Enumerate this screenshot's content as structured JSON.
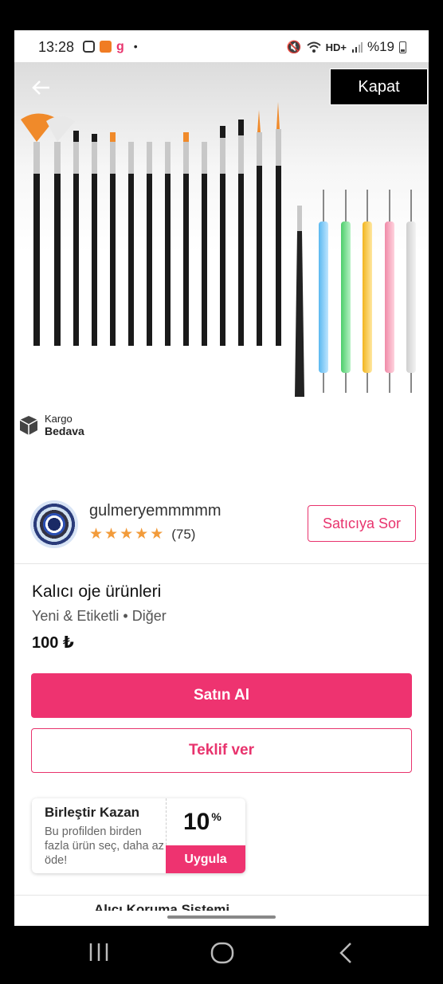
{
  "status_bar": {
    "time": "13:28",
    "network": "HD+",
    "battery": "%19"
  },
  "header": {
    "close_label": "Kapat"
  },
  "badge": {
    "line1": "Kargo",
    "line2": "Bedava"
  },
  "seller": {
    "name": "gulmeryemmmmm",
    "rating_stars": 5,
    "review_count": "(75)",
    "ask_label": "Satıcıya Sor"
  },
  "product": {
    "title": "Kalıcı oje ürünleri",
    "meta": "Yeni & Etiketli • Diğer",
    "price": "100 ₺"
  },
  "actions": {
    "buy_label": "Satın Al",
    "offer_label": "Teklif ver"
  },
  "promo": {
    "title": "Birleştir Kazan",
    "description": "Bu profilden birden fazla ürün seç, daha az öde!",
    "percent": "10",
    "percent_sign": "%",
    "apply_label": "Uygula"
  },
  "footer": {
    "partial_text": "Alıcı Koruma Sistemi"
  },
  "colors": {
    "accent": "#ee3370",
    "star": "#f29b3a"
  }
}
